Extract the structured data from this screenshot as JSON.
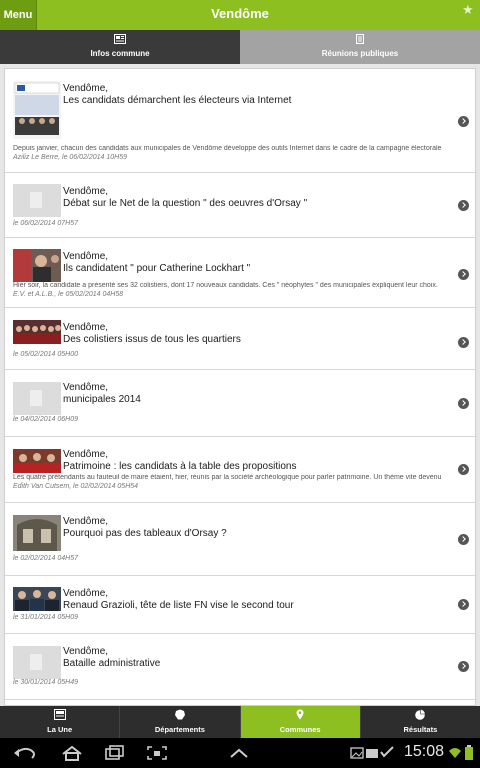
{
  "header": {
    "menu_label": "Menu",
    "title": "Vendôme"
  },
  "tabs": [
    {
      "label": "Infos commune",
      "icon": "newspaper-icon",
      "active": true
    },
    {
      "label": "Réunions publiques",
      "icon": "document-icon",
      "active": false
    }
  ],
  "articles": [
    {
      "town": "Vendôme,",
      "title": "Les candidats démarchent les électeurs via Internet",
      "excerpt": "Depuis janvier, chacun des candidats aux municipales de Vendôme développe des outils Internet dans le cadre de la campagne électorale",
      "meta": "Aziliz Le Berre, le 06/02/2014 10H59",
      "thumb": "photo"
    },
    {
      "town": "Vendôme,",
      "title": "Débat sur le Net de la question \" des oeuvres d'Orsay \"",
      "excerpt": "",
      "meta": "le 06/02/2014 07H57",
      "thumb": "placeholder"
    },
    {
      "town": "Vendôme,",
      "title": "Ils candidatent \" pour Catherine Lockhart \"",
      "excerpt": "Hier soir, la candidate a présenté ses 32 colistiers, dont 17 nouveaux candidats. Ces \" néophytes \" des municipales expliquent leur choix.",
      "meta": "E.V. et A.L.B., le 05/02/2014 04H58",
      "thumb": "photo"
    },
    {
      "town": "Vendôme,",
      "title": "Des colistiers issus de tous les quartiers",
      "excerpt": "",
      "meta": "le 05/02/2014 05H00",
      "thumb": "photo"
    },
    {
      "town": "Vendôme,",
      "title": "municipales 2014",
      "excerpt": "",
      "meta": "le 04/02/2014 06H09",
      "thumb": "placeholder"
    },
    {
      "town": "Vendôme,",
      "title": "Patrimoine : les candidats à la table des propositions",
      "excerpt": "Les quatre prétendants au fauteuil de maire étaient, hier, réunis par la société archéologique pour parler patrimoine. Un thème vite devenu",
      "meta": "Edith Van Cutsem, le 02/02/2014 05H54",
      "thumb": "photo"
    },
    {
      "town": "Vendôme,",
      "title": "Pourquoi pas des tableaux d'Orsay ?",
      "excerpt": "",
      "meta": "le 02/02/2014 04H57",
      "thumb": "photo"
    },
    {
      "town": "Vendôme,",
      "title": "Renaud Grazioli, tête de liste FN vise le second tour",
      "excerpt": "",
      "meta": "le 31/01/2014 05H09",
      "thumb": "photo"
    },
    {
      "town": "Vendôme,",
      "title": "Bataille administrative",
      "excerpt": "",
      "meta": "le 30/01/2014 05H49",
      "thumb": "placeholder"
    }
  ],
  "bottom_nav": [
    {
      "label": "La Une",
      "icon": "newspaper-icon",
      "active": false
    },
    {
      "label": "Départements",
      "icon": "map-icon",
      "active": false
    },
    {
      "label": "Communes",
      "icon": "location-pin-icon",
      "active": true
    },
    {
      "label": "Résultats",
      "icon": "pie-chart-icon",
      "active": false
    }
  ],
  "system_bar": {
    "time": "15:08"
  },
  "colors": {
    "accent": "#8cbf1f",
    "dark_tab": "#3a3a3a",
    "inactive_tab": "#a3a3a3"
  }
}
